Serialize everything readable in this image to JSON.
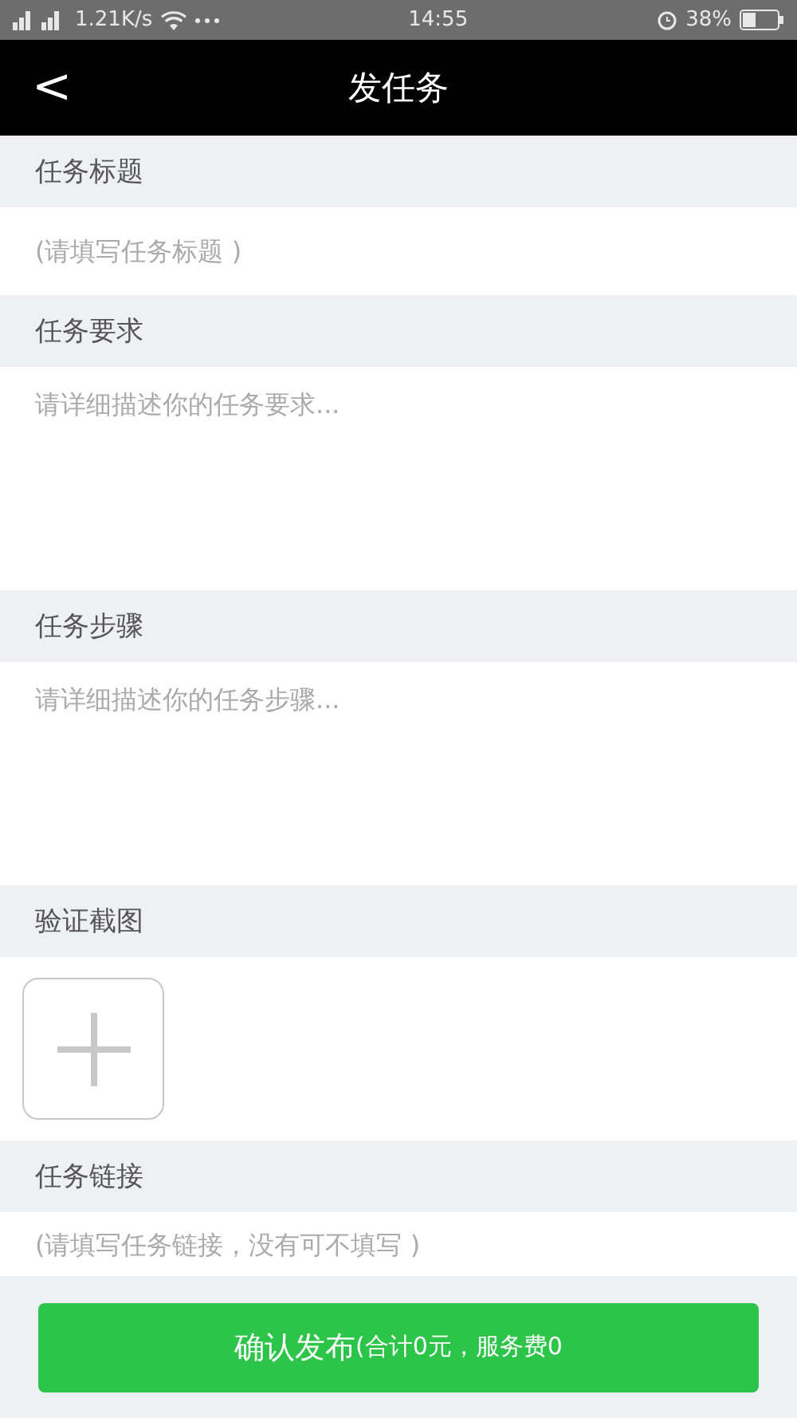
{
  "status_bar": {
    "speed": "1.21K/s",
    "time": "14:55",
    "battery": "38%"
  },
  "header": {
    "back": "<",
    "title": "发任务"
  },
  "sections": [
    {
      "kind": "input",
      "label": "任务标题",
      "placeholder": "(请填写任务标题 )"
    },
    {
      "kind": "textarea",
      "label": "任务要求",
      "placeholder": "请详细描述你的任务要求..."
    },
    {
      "kind": "textarea",
      "label": "任务步骤",
      "placeholder": "请详细描述你的任务步骤..."
    },
    {
      "kind": "upload",
      "label": "验证截图"
    },
    {
      "kind": "input",
      "label": "任务链接",
      "placeholder": "(请填写任务链接，没有可不填写 )"
    }
  ],
  "submit": {
    "label": "确认发布",
    "detail": "(合计0元，服务费0"
  }
}
